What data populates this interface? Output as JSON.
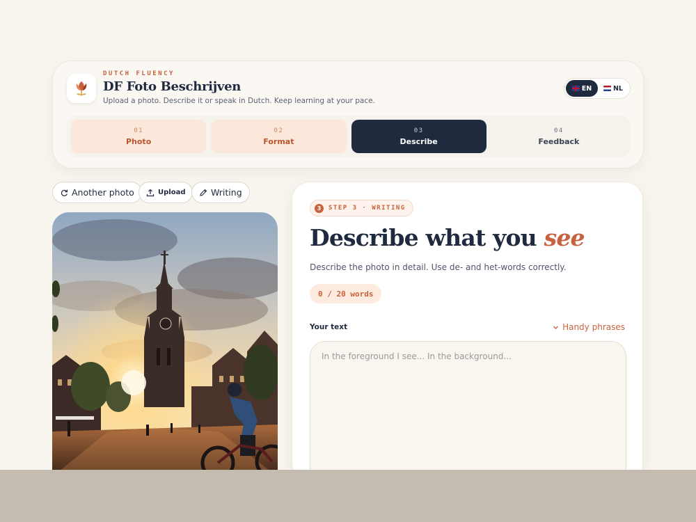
{
  "header": {
    "eyebrow": "DUTCH FLUENCY",
    "title": "DF Foto Beschrijven",
    "subtitle": "Upload a photo. Describe it or speak in Dutch. Keep learning at your pace.",
    "languages": [
      {
        "code": "EN",
        "flag": "uk-flag-icon",
        "active": true
      },
      {
        "code": "NL",
        "flag": "nl-flag-icon",
        "active": false
      }
    ]
  },
  "steps": [
    {
      "num": "01",
      "label": "Photo",
      "state": "done"
    },
    {
      "num": "02",
      "label": "Format",
      "state": "done"
    },
    {
      "num": "03",
      "label": "Describe",
      "state": "current"
    },
    {
      "num": "04",
      "label": "Feedback",
      "state": "todo"
    }
  ],
  "toolbar": {
    "another_photo": "Another photo",
    "upload": "Upload",
    "writing": "Writing"
  },
  "photo": {
    "subject": "Church tower at sunset with cyclist on cobbled square"
  },
  "writing": {
    "step_num": "3",
    "step_label": "STEP 3 · WRITING",
    "heading_main": "Describe what you ",
    "heading_accent": "see",
    "description": "Describe the photo in detail. Use de- and het-words correctly.",
    "counter": "0 / 20 words",
    "your_text_label": "Your text",
    "phrases_label": "Handy phrases",
    "placeholder": "In the foreground I see... In the background..."
  },
  "colors": {
    "accent": "#c8613e",
    "navy": "#1f2a3f",
    "background": "#f8f4ee"
  }
}
